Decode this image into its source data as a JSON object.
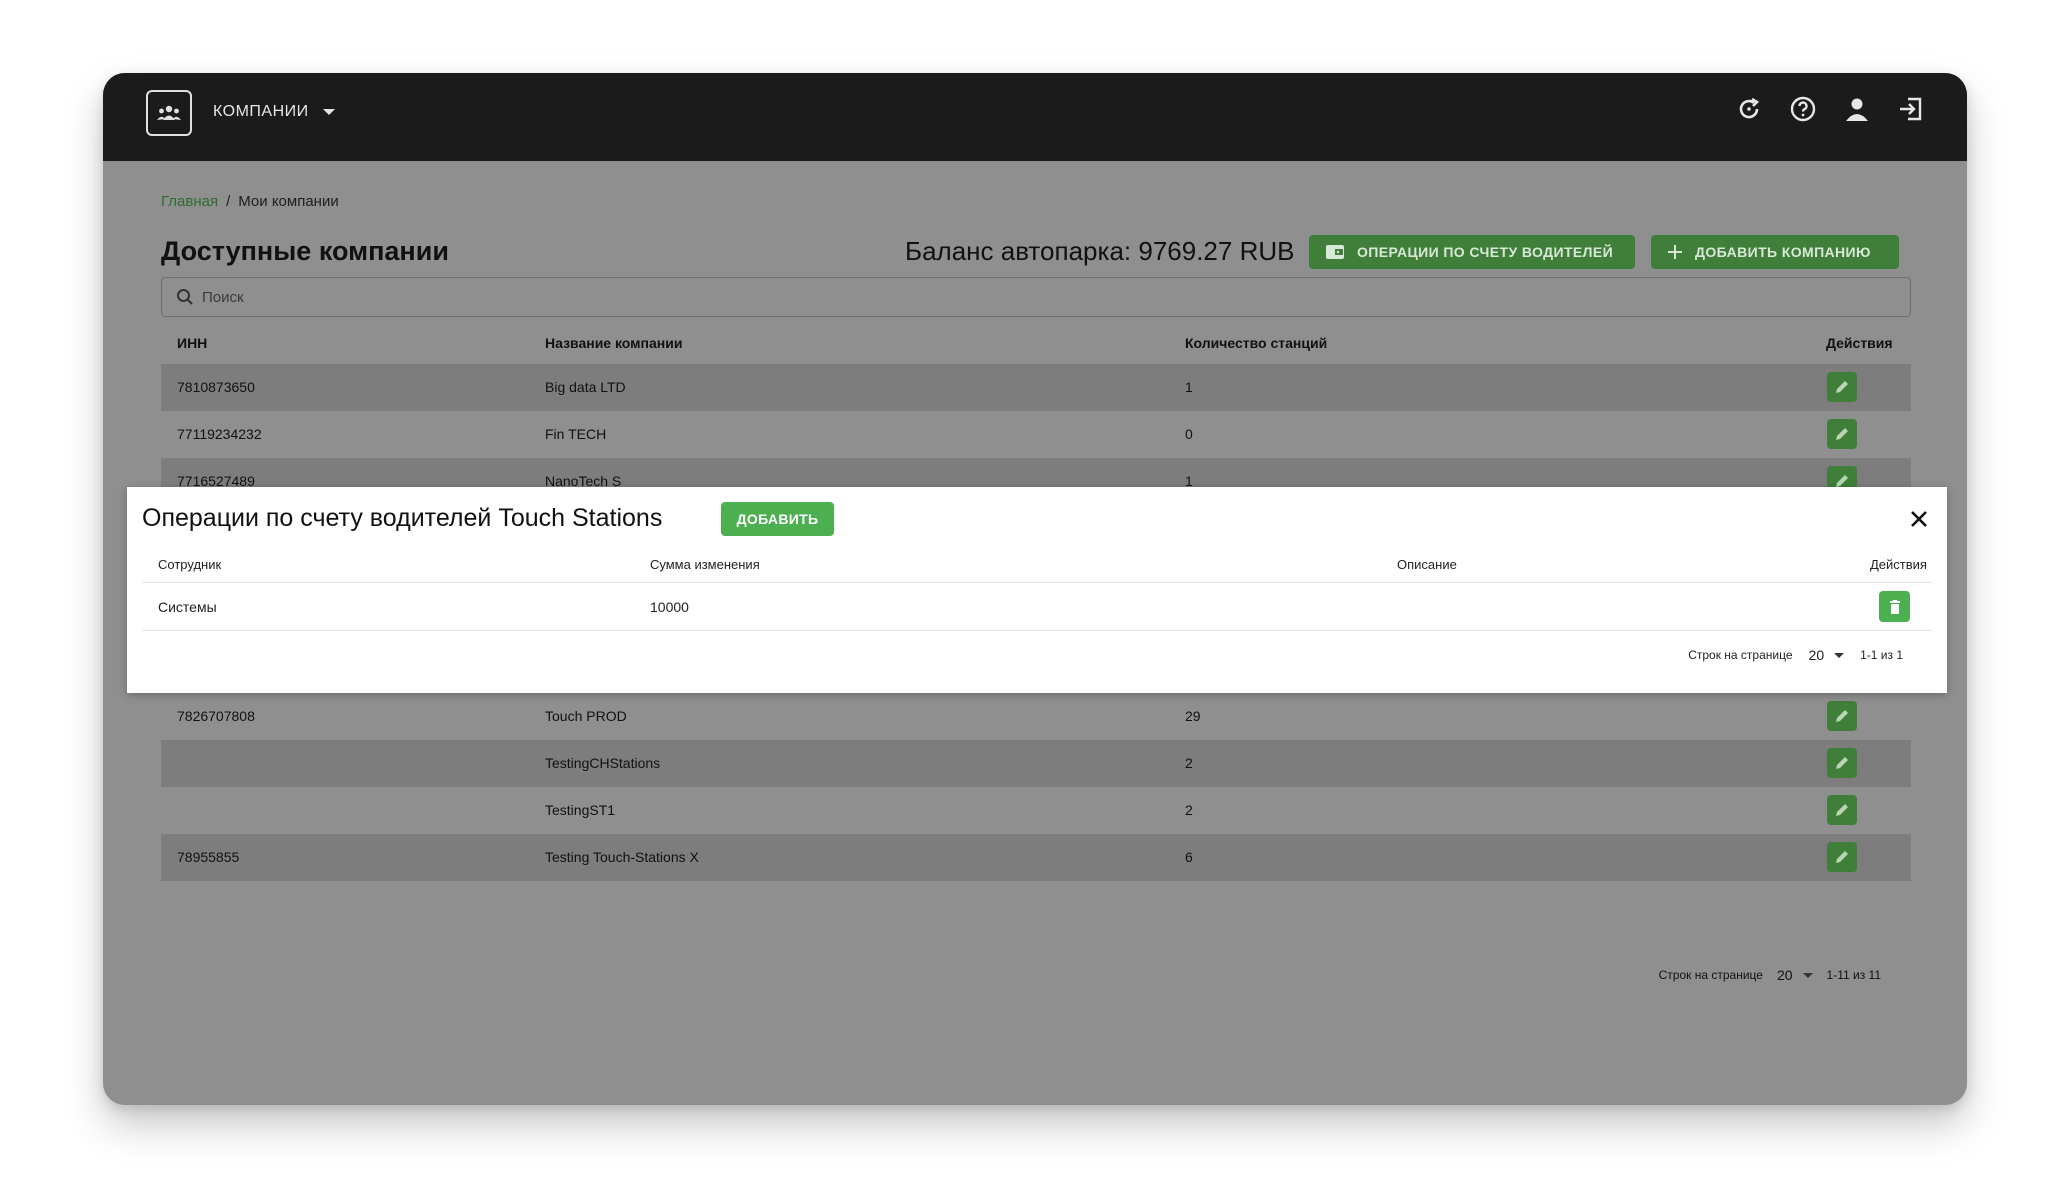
{
  "nav": {
    "menu_label": "КОМПАНИИ"
  },
  "breadcrumb": {
    "home": "Главная",
    "separator": "/",
    "current": "Мои компании"
  },
  "page": {
    "title": "Доступные компании",
    "balance": "Баланс автопарка: 9769.27 RUB",
    "ops_button": "ОПЕРАЦИИ ПО СЧЕТУ ВОДИТЕЛЕЙ",
    "add_company_button": "ДОБАВИТЬ КОМПАНИЮ"
  },
  "search": {
    "placeholder": "Поиск",
    "value": ""
  },
  "table": {
    "headers": [
      "ИНН",
      "Название компании",
      "Количество станций",
      "Действия"
    ],
    "rows": [
      {
        "inn": "7810873650",
        "name": "Big data LTD",
        "stations": "1"
      },
      {
        "inn": "77119234232",
        "name": "Fin TECH",
        "stations": "0"
      },
      {
        "inn": "7716527489",
        "name": "NanoTech S",
        "stations": "1"
      },
      {
        "inn": "7826707808",
        "name": "Touch PROD",
        "stations": "29"
      },
      {
        "inn": "",
        "name": "TestingCHStations",
        "stations": "2"
      },
      {
        "inn": "",
        "name": "TestingST1",
        "stations": "2"
      },
      {
        "inn": "78955855",
        "name": "Testing Touch-Stations X",
        "stations": "6"
      }
    ],
    "pager": {
      "label": "Строк на странице",
      "per_page": "20",
      "range": "1-11 из 11"
    }
  },
  "modal": {
    "title": "Операции по счету водителей Touch Stations",
    "add_button": "ДОБАВИТЬ",
    "headers": [
      "Сотрудник",
      "Сумма изменения",
      "Описание",
      "Действия"
    ],
    "rows": [
      {
        "employee": "Системы",
        "amount": "10000",
        "description": ""
      }
    ],
    "pager": {
      "label": "Строк на странице",
      "per_page": "20",
      "range": "1-1 из 1"
    }
  },
  "colors": {
    "topbar": "#1b1b1b",
    "overlay": "#8f8f8f",
    "accent": "#4caf50",
    "accent_dim": "#3f7f3a"
  }
}
